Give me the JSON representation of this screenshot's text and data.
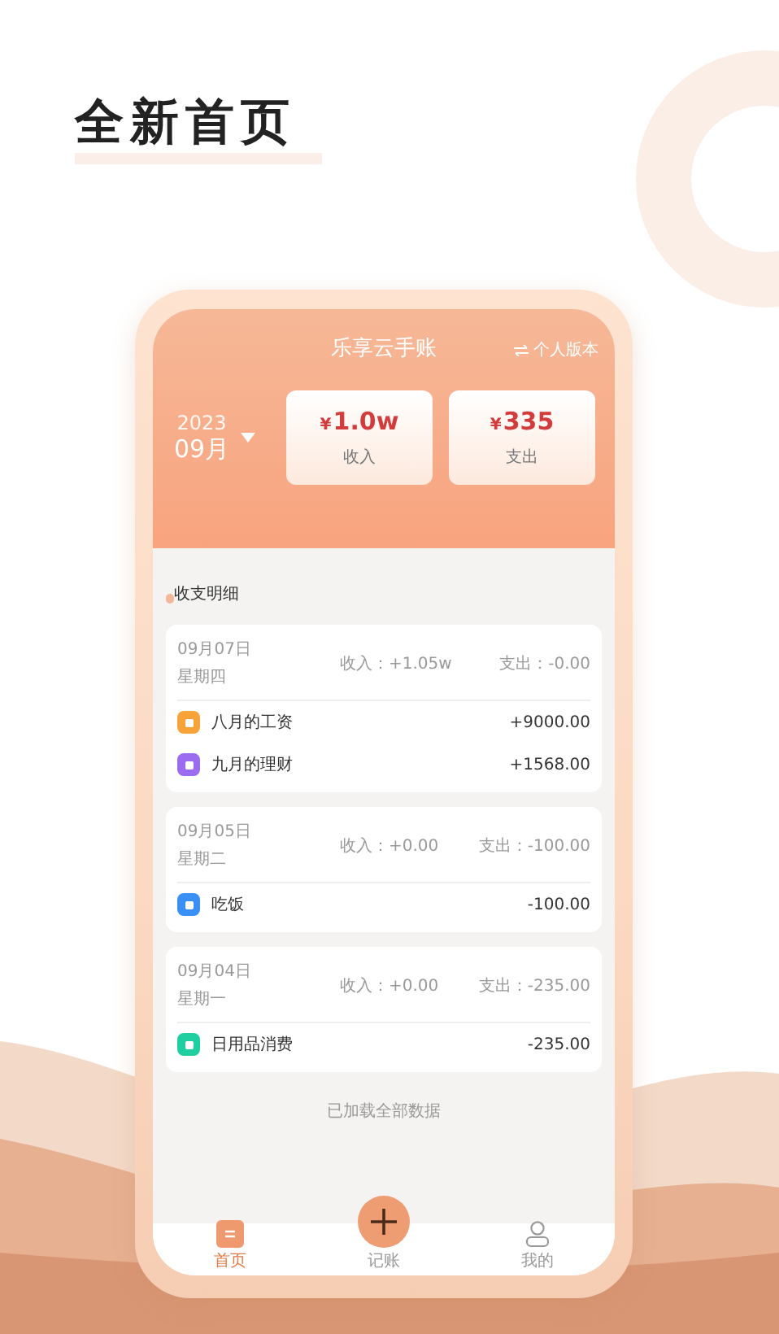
{
  "headline": "全新首页",
  "app": {
    "title": "乐享云手账",
    "switch_label": "个人版本",
    "year": "2023",
    "month": "09月",
    "summary": [
      {
        "currency": "¥",
        "amount": "1.0w",
        "label": "收入"
      },
      {
        "currency": "¥",
        "amount": "335",
        "label": "支出"
      }
    ],
    "section_title": "收支明细",
    "days": [
      {
        "date": "09月07日",
        "weekday": "星期四",
        "income": "收入：+1.05w",
        "expense": "支出：-0.00",
        "entries": [
          {
            "name": "八月的工资",
            "amount": "+9000.00",
            "color": "#f7a33a"
          },
          {
            "name": "九月的理财",
            "amount": "+1568.00",
            "color": "#9b6cf0"
          }
        ]
      },
      {
        "date": "09月05日",
        "weekday": "星期二",
        "income": "收入：+0.00",
        "expense": "支出：-100.00",
        "entries": [
          {
            "name": "吃饭",
            "amount": "-100.00",
            "color": "#3a8ff5"
          }
        ]
      },
      {
        "date": "09月04日",
        "weekday": "星期一",
        "income": "收入：+0.00",
        "expense": "支出：-235.00",
        "entries": [
          {
            "name": "日用品消费",
            "amount": "-235.00",
            "color": "#1fcf9f"
          }
        ]
      }
    ],
    "footer_note": "已加载全部数据",
    "tabs": [
      {
        "label": "首页",
        "kind": "home",
        "selected": true
      },
      {
        "label": "记账",
        "kind": "add",
        "selected": false
      },
      {
        "label": "我的",
        "kind": "profile",
        "selected": false
      }
    ]
  }
}
